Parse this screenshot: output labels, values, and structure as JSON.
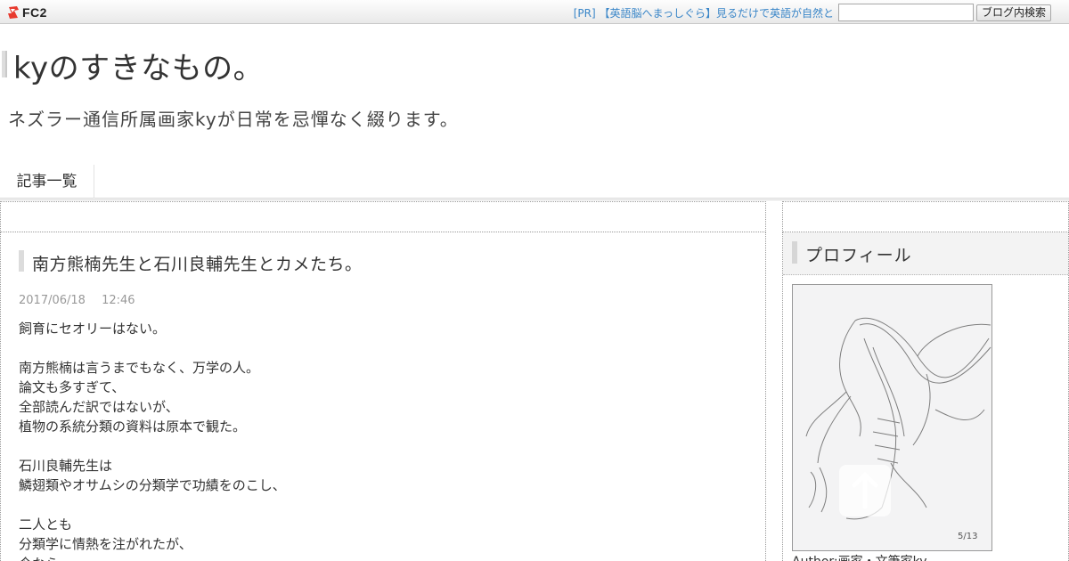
{
  "fc2bar": {
    "logo_text": "FC2",
    "pr_link": "[PR] 【英語脳へまっしぐら】見るだけで英語が自然と",
    "search_placeholder": "",
    "search_button": "ブログ内検索"
  },
  "header": {
    "title": "kyのすきなもの。",
    "description": "ネズラー通信所属画家kyが日常を忌憚なく綴ります。"
  },
  "nav": {
    "items": [
      {
        "label": "記事一覧"
      }
    ]
  },
  "entry": {
    "title": "南方熊楠先生と石川良輔先生とカメたち。",
    "date": "2017/06/18",
    "time": "12:46",
    "lines": [
      "飼育にセオリーはない。",
      "",
      "南方熊楠は言うまでもなく、万学の人。",
      "論文も多すぎて、",
      "全部読んだ訳ではないが、",
      "植物の系統分類の資料は原本で観た。",
      "",
      "石川良輔先生は",
      "鱗翅類やオサムシの分類学で功績をのこし、",
      "",
      "二人とも",
      "分類学に情熱を注がれたが、",
      "今なら"
    ]
  },
  "sidebar": {
    "profile_title": "プロフィール",
    "author": "Author:画家・文筆家ky"
  },
  "icons": {
    "fc2": "fc2-logo-icon",
    "totop": "arrow-up-icon"
  },
  "colors": {
    "link": "#3a86c8"
  }
}
